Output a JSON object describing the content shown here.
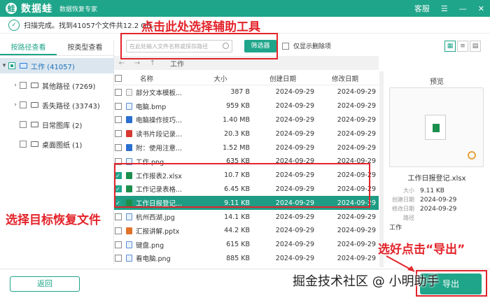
{
  "app": {
    "logo_char": "蛙",
    "name": "数据蛙",
    "subtitle": "数据恢复专家",
    "support": "客服",
    "menu_icon": "☰",
    "min_icon": "—",
    "close_icon": "✕"
  },
  "status": {
    "text": "扫描完成。找到41057个文件共12.2 GB。"
  },
  "annotations": {
    "top": "点击此处选择辅助工具",
    "left": "选择目标恢复文件",
    "right": "选好点击“导出”"
  },
  "left_panel": {
    "tabs": [
      "按路径查看",
      "按类型查看"
    ],
    "tree": [
      {
        "label": "工作 (41057)"
      },
      {
        "label": "其他路径 (7269)"
      },
      {
        "label": "丢失路径 (33743)"
      },
      {
        "label": "日常图库 (2)"
      },
      {
        "label": "桌面图纸 (1)"
      }
    ]
  },
  "filter": {
    "search_placeholder": "在此处输入文件名称或保存路径",
    "filter_button": "筛选器",
    "only_deleted": "仅显示删除项"
  },
  "path": {
    "current": "工作"
  },
  "table": {
    "headers": [
      "名称",
      "大小",
      "创建日期",
      "修改日期"
    ],
    "rows": [
      {
        "name": "部分文本模板...",
        "size": "387  B",
        "created": "2024-09-29",
        "modified": "2024-09-29",
        "icon": "doc-icon",
        "checked": false
      },
      {
        "name": "电脑.bmp",
        "size": "959 KB",
        "created": "2024-09-29",
        "modified": "2024-09-29",
        "icon": "image-icon",
        "checked": false
      },
      {
        "name": "电脑操作技巧...",
        "size": "1.40 MB",
        "created": "2024-09-29",
        "modified": "2024-09-29",
        "icon": "word-icon",
        "checked": false
      },
      {
        "name": "读书片段记录...",
        "size": "20.3 KB",
        "created": "2024-09-29",
        "modified": "2024-09-29",
        "icon": "pdf-icon",
        "checked": false
      },
      {
        "name": "附：使用注意...",
        "size": "1.52 MB",
        "created": "2024-09-29",
        "modified": "2024-09-29",
        "icon": "word-icon",
        "checked": false
      },
      {
        "name": "工作.png",
        "size": "635 KB",
        "created": "2024-09-29",
        "modified": "2024-09-29",
        "icon": "image-icon",
        "checked": false
      },
      {
        "name": "工作报表2.xlsx",
        "size": "10.7 KB",
        "created": "2024-09-29",
        "modified": "2024-09-29",
        "icon": "excel-icon",
        "checked": true
      },
      {
        "name": "工作记录表格...",
        "size": "6.45 KB",
        "created": "2024-09-29",
        "modified": "2024-09-29",
        "icon": "excel-icon",
        "checked": true
      },
      {
        "name": "工作日报登记...",
        "size": "9.11 KB",
        "created": "2024-09-29",
        "modified": "2024-09-29",
        "icon": "excel-icon",
        "checked": true,
        "selected": true
      },
      {
        "name": "杭州西湖.jpg",
        "size": "14.1 KB",
        "created": "2024-09-29",
        "modified": "2024-09-29",
        "icon": "image-icon",
        "checked": false
      },
      {
        "name": "汇报讲解.pptx",
        "size": "44.2 KB",
        "created": "2024-09-29",
        "modified": "2024-09-29",
        "icon": "ppt-icon",
        "checked": false
      },
      {
        "name": "键盘.png",
        "size": "615 KB",
        "created": "2024-09-29",
        "modified": "2024-09-29",
        "icon": "image-icon",
        "checked": false
      },
      {
        "name": "看电脑.png",
        "size": "885 KB",
        "created": "2024-09-29",
        "modified": "2024-09-29",
        "icon": "image-icon",
        "checked": false
      },
      {
        "name": "目录.wps",
        "size": "15.1 KB",
        "created": "2024-09-29",
        "modified": "2024-09-29",
        "icon": "word-icon",
        "checked": false
      }
    ]
  },
  "preview": {
    "title": "预览",
    "file_name": "工作日报登记.xlsx",
    "size_label": "大小",
    "size": "9.11 KB",
    "created_label": "创建日期",
    "created": "2024-09-29",
    "modified_label": "修改日期",
    "modified": "2024-09-29",
    "path_label": "路径",
    "path": "工作"
  },
  "footer": {
    "back": "返回",
    "export": "导出"
  },
  "watermark": "掘金技术社区 @ 小明助手",
  "colors": {
    "accent": "#1fa58a",
    "annotation_red": "#e3242b"
  }
}
